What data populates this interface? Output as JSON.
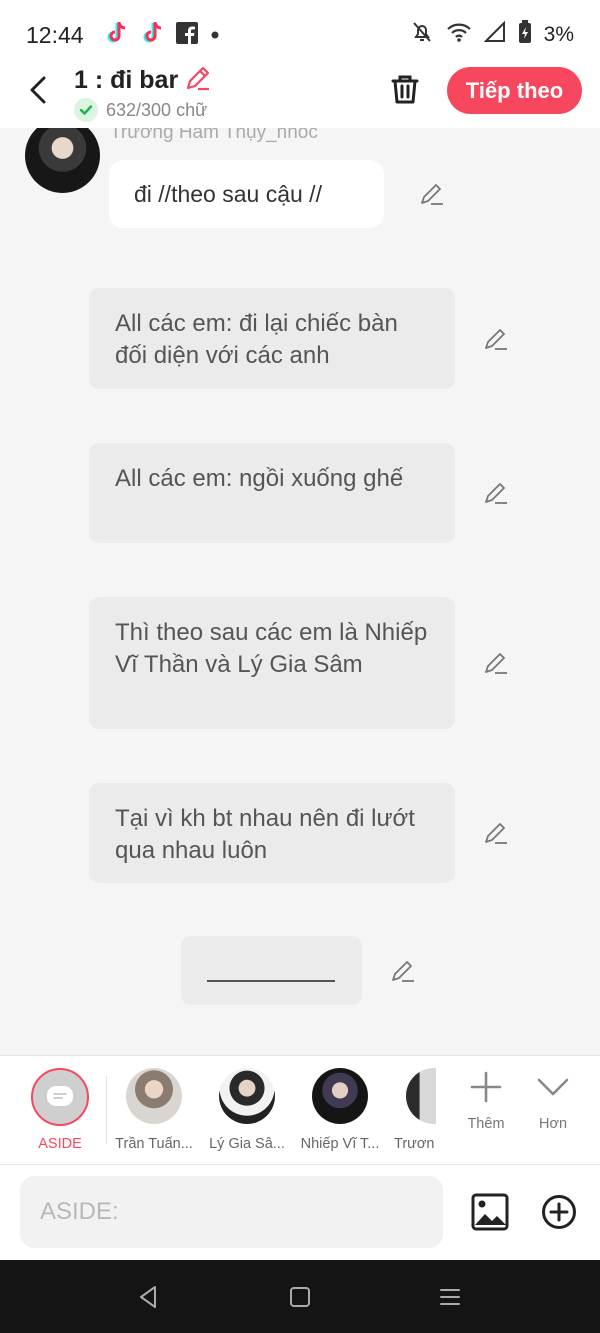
{
  "status_bar": {
    "time": "12:44",
    "battery": "3%"
  },
  "header": {
    "title": "1 : đi bar",
    "word_count": "632/300 chữ",
    "next_label": "Tiếp theo"
  },
  "chat": {
    "speaker_name": "Trương Hàm Thụy_nhóc",
    "dialogue": "đi //theo sau cậu //",
    "asides": [
      "All các em: đi lại chiếc bàn đối diện với các anh",
      "All các em: ngồi xuống ghế",
      "Thì theo sau các em là Nhiếp Vĩ Thần và Lý Gia Sâm",
      "Tại vì kh bt nhau nên đi lướt qua nhau luôn"
    ]
  },
  "characters": [
    {
      "label": "ASIDE"
    },
    {
      "label": "Trần Tuấn..."
    },
    {
      "label": "Lý Gia Sâ..."
    },
    {
      "label": "Nhiếp Vĩ T..."
    },
    {
      "label": "Trươn"
    }
  ],
  "tools": {
    "add_label": "Thêm",
    "more_label": "Hơn"
  },
  "input": {
    "placeholder": "ASIDE:"
  },
  "colors": {
    "accent": "#f6475f",
    "background": "#f5f5f5",
    "bubble_gray": "#ebebeb"
  }
}
